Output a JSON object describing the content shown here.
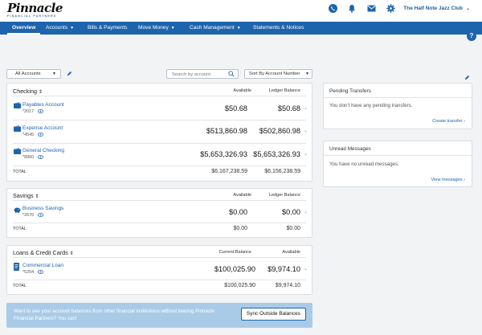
{
  "brand": {
    "name": "Pinnacle",
    "tagline": "FINANCIAL PARTNERS"
  },
  "header": {
    "club_name": "The Half Note Jazz Club"
  },
  "nav": {
    "items": [
      {
        "label": "Overview"
      },
      {
        "label": "Accounts"
      },
      {
        "label": "Bills & Payments"
      },
      {
        "label": "Move Money"
      },
      {
        "label": "Cash Management"
      },
      {
        "label": "Statements & Notices"
      }
    ],
    "help": "?"
  },
  "filters": {
    "account_filter": "All Accounts",
    "search_placeholder": "Search by account",
    "sort": "Sort By Account Number"
  },
  "checking": {
    "title": "Checking",
    "col1": "Available",
    "col2": "Ledger Balance",
    "rows": [
      {
        "name": "Payables Account",
        "number": "*2017",
        "available": "$50.68",
        "ledger": "$50.68"
      },
      {
        "name": "Expense Account",
        "number": "*4545",
        "available": "$513,860.98",
        "ledger": "$502,860.98"
      },
      {
        "name": "General Checking",
        "number": "*8960",
        "available": "$5,653,326.93",
        "ledger": "$5,653,326.93"
      }
    ],
    "total_label": "TOTAL",
    "total_available": "$6,167,238.59",
    "total_ledger": "$6,156,238.59"
  },
  "savings": {
    "title": "Savings",
    "col1": "Available",
    "col2": "Ledger Balance",
    "rows": [
      {
        "name": "Business Savings",
        "number": "*2670",
        "available": "$0.00",
        "ledger": "$0.00"
      }
    ],
    "total_label": "TOTAL",
    "total_available": "$0.00",
    "total_ledger": "$0.00"
  },
  "loans": {
    "title": "Loans & Credit Cards",
    "col1": "Current Balance",
    "col2": "Available",
    "rows": [
      {
        "name": "Commercial Loan",
        "number": "*5254",
        "available": "$100,025.90",
        "ledger": "$9,974.10"
      }
    ],
    "total_label": "TOTAL",
    "total_available": "$100,025.90",
    "total_ledger": "$9,974.10"
  },
  "pending": {
    "title": "Pending Transfers",
    "body": "You don't have any pending transfers.",
    "link": "Create transfer"
  },
  "messages": {
    "title": "Unread Messages",
    "body": "You have no unread messages.",
    "link": "View messages"
  },
  "banner": {
    "text": "Want to see your account balances from other financial institutions without leaving Pinnacle Financial Partners? You can!",
    "button": "Sync Outside Balances"
  },
  "colors": {
    "primary": "#1d64ad",
    "banner": "#a9cbe8",
    "background": "#f2f3f5"
  }
}
